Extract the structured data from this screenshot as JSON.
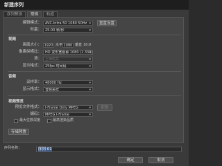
{
  "window": {
    "title": "新建序列"
  },
  "tabs": [
    {
      "label": "序列预设"
    },
    {
      "label": "常规"
    },
    {
      "label": "轨道"
    }
  ],
  "general": {
    "edit_mode_label": "编辑模式：",
    "edit_mode_value": "AVC-Intra 50 1080 50Hz",
    "reset_button": "重置设置",
    "timebase_label": "时基：",
    "timebase_value": "25.00 帧/秒"
  },
  "video": {
    "section": "视频",
    "frame_size_label": "画面大小：",
    "frame_width": "1920",
    "frame_h_label": "水平",
    "frame_height": "1080",
    "frame_v_label": "垂直",
    "aspect": "16:9",
    "pixel_aspect_label": "像素纵横比：",
    "pixel_aspect_value": "HD 变形宽银幕 1080 (1.333)",
    "field_label": "场：",
    "field_value": "上场优先",
    "display_format_label": "显示格式：",
    "display_format_value": "25fps 时间码"
  },
  "audio": {
    "section": "音频",
    "sample_rate_label": "采样率：",
    "sample_rate_value": "48000 Hz",
    "display_format_label": "显示格式：",
    "display_format_value": "音频采样"
  },
  "preview": {
    "section": "视频预览",
    "preview_format_label": "预览文件格式：",
    "preview_format_value": "I-Frame Only MPEG",
    "config_button": "配置",
    "codec_label": "编码：",
    "codec_value": "MPEG I-Frame",
    "max_bit_depth": "最大位数深度",
    "max_render_quality": "最高渲染品质"
  },
  "save_preset_button": "存储预置",
  "sequence_name_label": "序列名称：",
  "sequence_name_value": "序列 01",
  "ok_button": "确定",
  "cancel_button": "取消"
}
